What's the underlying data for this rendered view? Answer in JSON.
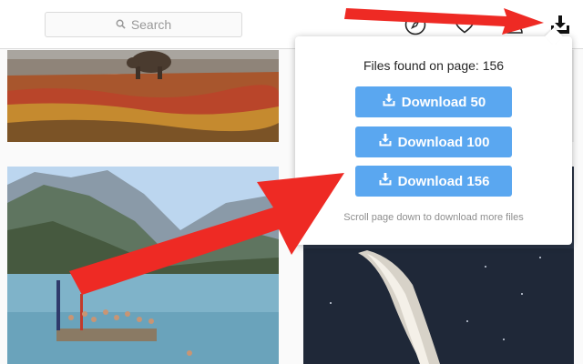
{
  "search": {
    "placeholder": "Search"
  },
  "icons": {
    "search": "search-icon",
    "explore": "compass-icon",
    "activity": "heart-icon",
    "profile": "person-icon",
    "extension": "download-tray-icon",
    "download": "download-icon"
  },
  "popup": {
    "title": "Files found on page: 156",
    "buttons": [
      {
        "label": "Download 50"
      },
      {
        "label": "Download 100"
      },
      {
        "label": "Download 156"
      }
    ],
    "hint": "Scroll page down to download more files"
  },
  "colors": {
    "button": "#5aa7f0",
    "arrow": "#ee2a24",
    "topbar": "#ffffff"
  }
}
